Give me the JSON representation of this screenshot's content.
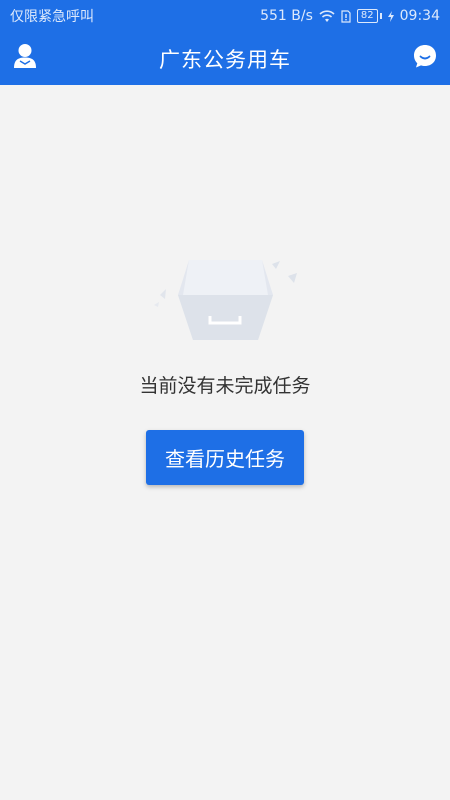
{
  "status_bar": {
    "carrier": "仅限紧急呼叫",
    "speed": "551 B/s",
    "battery": "82",
    "time": "09:34",
    "icons": [
      "wifi-icon",
      "sim-icon",
      "battery-icon",
      "charging-icon"
    ]
  },
  "app_bar": {
    "title": "广东公务用车",
    "left_icon": "user-icon",
    "right_icon": "chat-icon"
  },
  "empty_state": {
    "illustration": "empty-box-icon",
    "message": "当前没有未完成任务",
    "button_label": "查看历史任务"
  },
  "colors": {
    "primary": "#1e6fe6",
    "background": "#f3f3f3",
    "text": "#333333"
  }
}
